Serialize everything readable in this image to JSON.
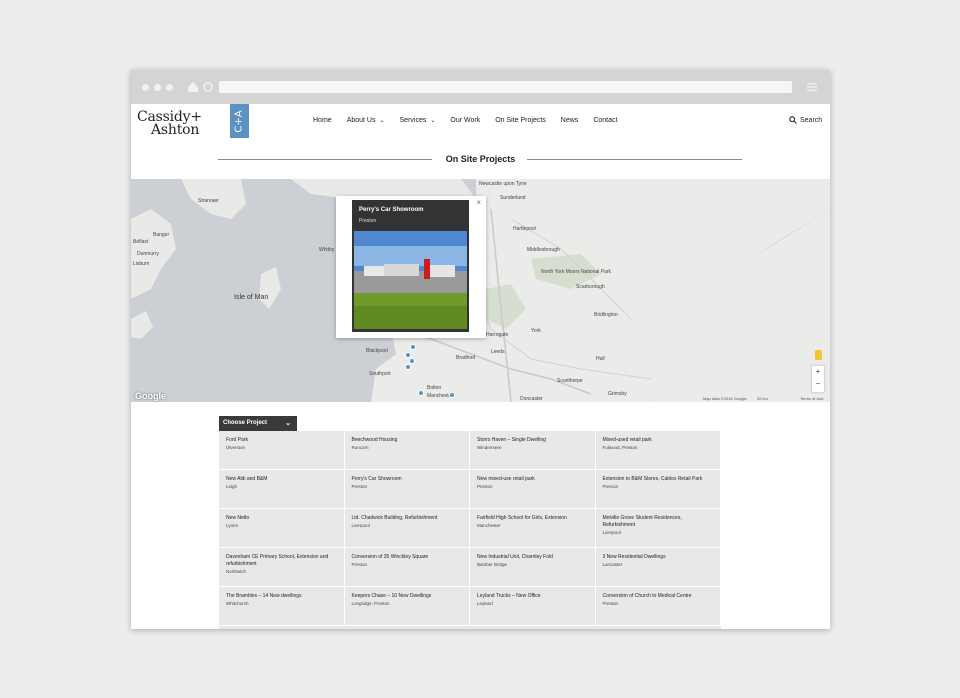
{
  "site": {
    "logo_line1": "Cassidy+",
    "logo_line2": "Ashton",
    "logo_mark": "C+A",
    "accent": "#5b92c3"
  },
  "nav": {
    "items": [
      {
        "label": "Home",
        "dropdown": false
      },
      {
        "label": "About Us",
        "dropdown": true
      },
      {
        "label": "Services",
        "dropdown": true
      },
      {
        "label": "Our Work",
        "dropdown": false
      },
      {
        "label": "On Site Projects",
        "dropdown": false
      },
      {
        "label": "News",
        "dropdown": false
      },
      {
        "label": "Contact",
        "dropdown": false
      }
    ],
    "search_label": "Search"
  },
  "page_title": "On Site Projects",
  "map": {
    "popup_title": "Perry's Car Showroom",
    "popup_location": "Preston",
    "close_symbol": "×",
    "zoom_in": "+",
    "zoom_out": "−",
    "google": "Google",
    "attribution_data": "Map data ©2016 Google",
    "attribution_scale": "20 km",
    "attribution_terms": "Terms of Use",
    "labels": {
      "isle_of_man": "Isle of Man",
      "newcastle": "Newcastle upon Tyne",
      "sunderland": "Sunderland",
      "hartlepool": "Hartlepool",
      "middlesbrough": "Middlesbrough",
      "north_york": "North York Moors National Park",
      "scarborough": "Scarborough",
      "bridlington": "Bridlington",
      "york": "York",
      "harrogate": "Harrogate",
      "leeds": "Leeds",
      "bradford": "Bradford",
      "blackpool": "Blackpool",
      "southport": "Southport",
      "bolton": "Bolton",
      "manchester": "Manchester",
      "hull": "Hull",
      "grimsby": "Grimsby",
      "scunthorpe": "Scunthorpe",
      "doncaster": "Doncaster",
      "bangor": "Bangor",
      "belfast": "Belfast",
      "dunmurry": "Dunmurry",
      "lisburn": "Lisburn",
      "stranraer": "Stranraer",
      "whitby": "Whitby"
    }
  },
  "projects": {
    "choose_label": "Choose Project",
    "items": [
      {
        "name": "Ford Park",
        "location": "Ulverston"
      },
      {
        "name": "Beechwood Housing",
        "location": "Runcorn"
      },
      {
        "name": "Storrs Haven – Single Dwelling",
        "location": "Windermere"
      },
      {
        "name": "Mixed-used retail park",
        "location": "Fulwood, Preston"
      },
      {
        "name": "New Aldi and B&M",
        "location": "Leigh"
      },
      {
        "name": "Perry's Car Showroom",
        "location": "Preston"
      },
      {
        "name": "New mixed-use retail park",
        "location": "Preston"
      },
      {
        "name": "Extension to B&M Stores, Cables Retail Park",
        "location": "Prescot"
      },
      {
        "name": "New Netto",
        "location": "Lymm"
      },
      {
        "name": "Ltd. Chadwick Building, Refurbishment",
        "location": "Liverpool"
      },
      {
        "name": "Fairfield High School for Girls, Extension",
        "location": "Manchester"
      },
      {
        "name": "Melville Grove Student Residences, Refurbishment",
        "location": "Liverpool"
      },
      {
        "name": "Davenham CE Primary School, Extension and refurbishment",
        "location": "Northwich"
      },
      {
        "name": "Conversion of 35 Winckley Square",
        "location": "Preston"
      },
      {
        "name": "New Industrial Unit, Charnley Fold",
        "location": "Bamber Bridge"
      },
      {
        "name": "3 New Residential Dwellings",
        "location": "Lancaster"
      },
      {
        "name": "The Brambles – 14 New dwellings",
        "location": "Whitchurch"
      },
      {
        "name": "Keepers Chase – 10 New Dwellings",
        "location": "Longridge, Preston"
      },
      {
        "name": "Leyland Trucks – New Office",
        "location": "Leyland"
      },
      {
        "name": "Conversion of Church to Medical Centre",
        "location": "Preston"
      }
    ]
  }
}
